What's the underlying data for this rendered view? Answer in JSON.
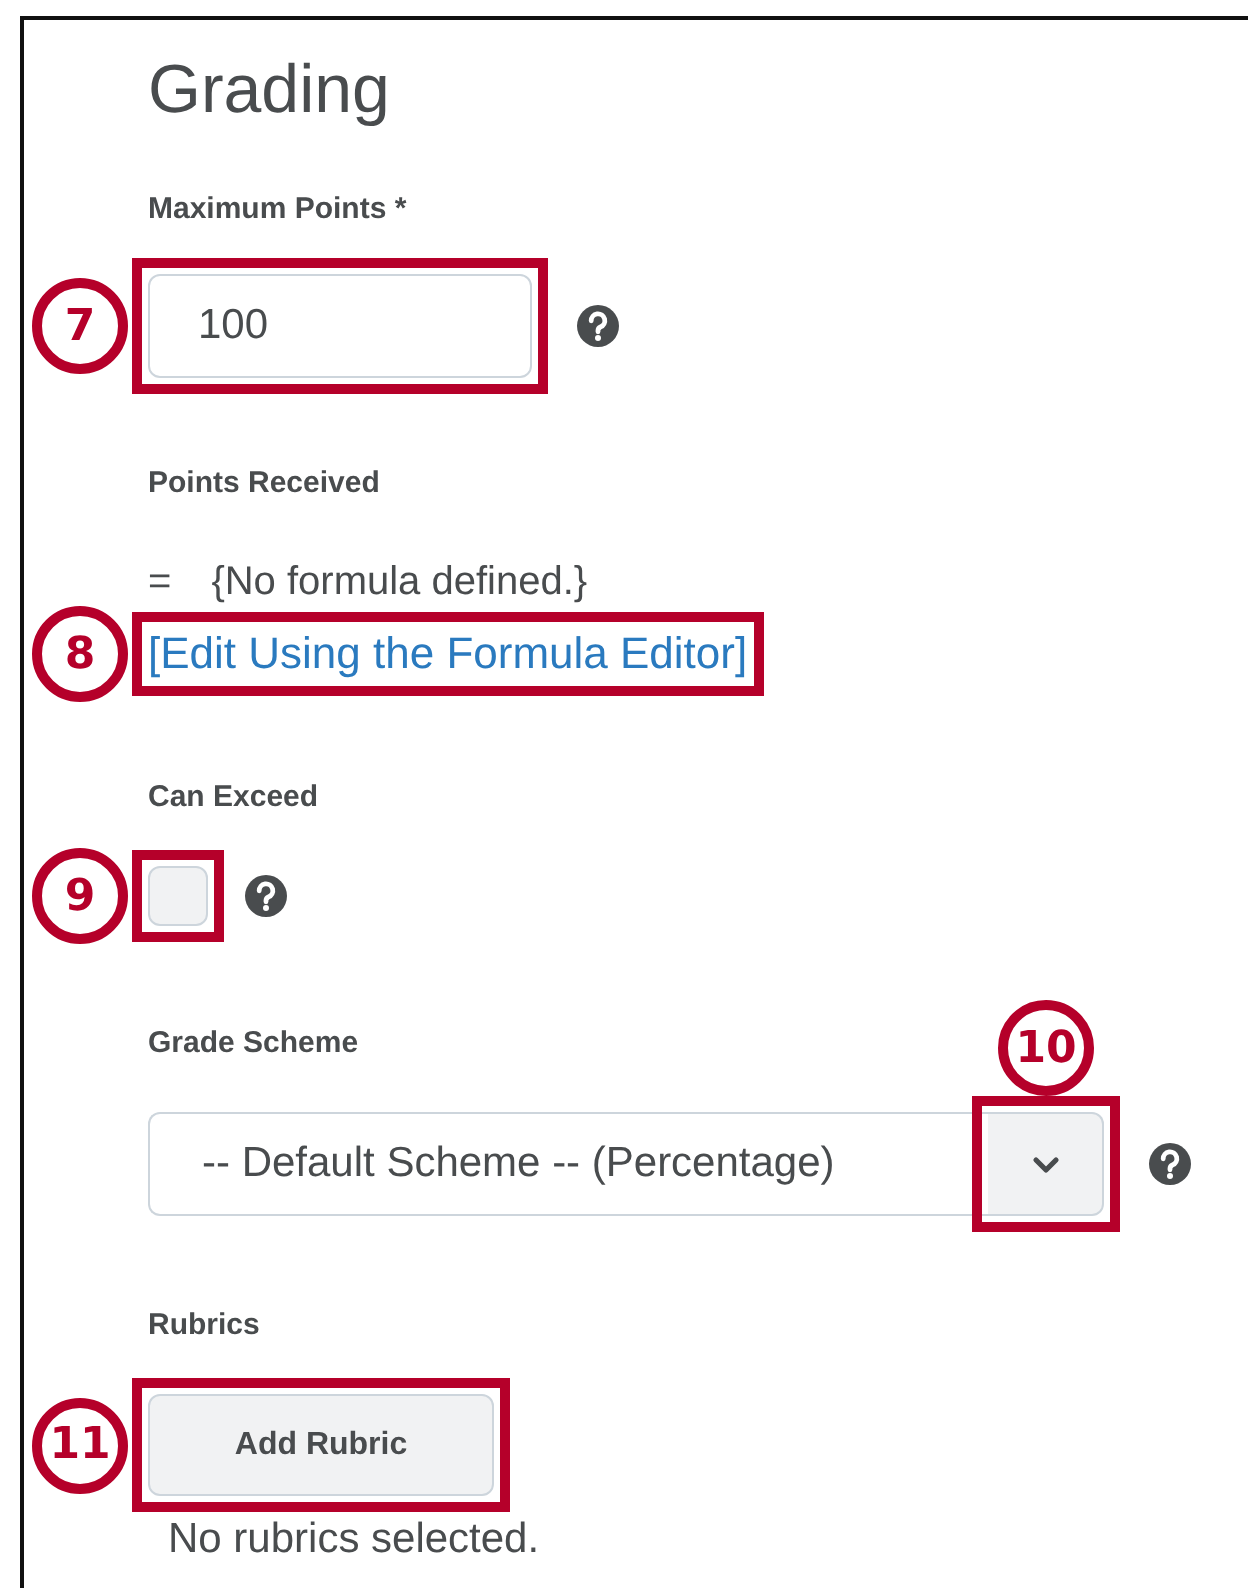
{
  "title": "Grading",
  "maximum_points": {
    "label": "Maximum Points *",
    "value": "100",
    "callout": "7"
  },
  "points_received": {
    "label": "Points Received",
    "equals": "=",
    "formula": "{No formula defined.}",
    "link": "[Edit Using the Formula Editor]",
    "callout": "8"
  },
  "can_exceed": {
    "label": "Can Exceed",
    "checked": false,
    "callout": "9"
  },
  "grade_scheme": {
    "label": "Grade Scheme",
    "value": "-- Default Scheme -- (Percentage)",
    "callout": "10"
  },
  "rubrics": {
    "label": "Rubrics",
    "button": "Add Rubric",
    "status": "No rubrics selected.",
    "callout": "11"
  }
}
